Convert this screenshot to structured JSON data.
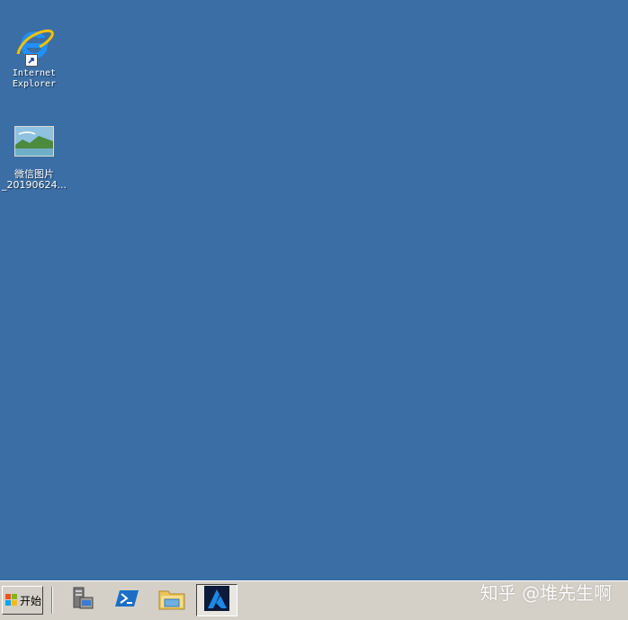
{
  "desktop": {
    "background_color": "#3a6ea5",
    "icons": [
      {
        "label": "Internet\nExplorer",
        "icon": "internet-explorer-icon",
        "shortcut": true
      },
      {
        "label": "微信图片\n_20190624...",
        "icon": "image-file-icon",
        "shortcut": false
      }
    ]
  },
  "taskbar": {
    "start_label": "开始",
    "start_icon": "windows-logo-icon",
    "quick_launch": [
      {
        "icon": "server-manager-icon"
      },
      {
        "icon": "powershell-icon"
      },
      {
        "icon": "file-explorer-icon"
      },
      {
        "icon": "app-a-icon",
        "active": true
      }
    ]
  },
  "watermark": {
    "text": "知乎 @堆先生啊"
  }
}
